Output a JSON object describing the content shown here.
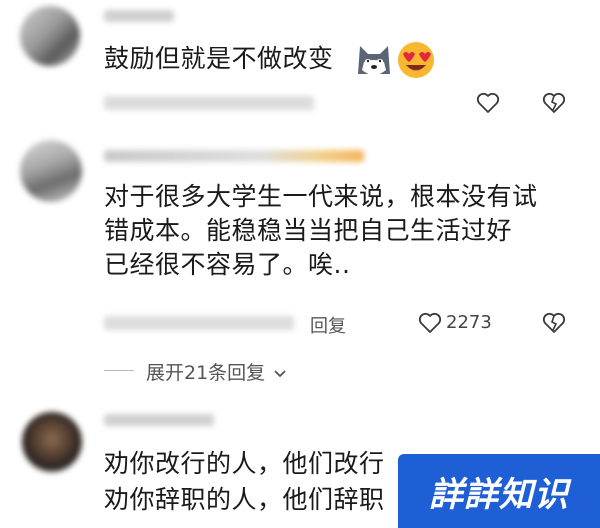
{
  "comments": [
    {
      "text": "鼓励但就是不做改变",
      "like_count": "",
      "emojis": [
        "doge-icon",
        "heart-eyes-icon"
      ]
    },
    {
      "text_lines": [
        "对于很多大学生一代来说，根本没有试",
        "错成本。能稳稳当当把自己生活过好",
        "已经很不容易了。唉.."
      ],
      "reply_label": "回复",
      "like_count": "2273",
      "expand_label": "展开21条回复"
    },
    {
      "text_lines": [
        "劝你改行的人，他们改行",
        "劝你辞职的人，他们辞职"
      ]
    }
  ],
  "watermark": {
    "text": "詳詳知识",
    "color": "#1f5fd6"
  },
  "icons": {
    "like": "heart-outline-icon",
    "dislike": "broken-heart-icon",
    "chevron": "chevron-down-icon"
  }
}
